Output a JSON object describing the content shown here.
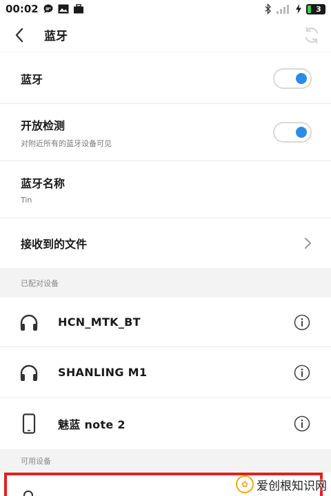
{
  "status_bar": {
    "time": "00:02",
    "battery_level": "3"
  },
  "header": {
    "title": "蓝牙"
  },
  "settings": {
    "bluetooth_label": "蓝牙",
    "bluetooth_enabled": true,
    "visibility_label": "开放检测",
    "visibility_sub": "对附近所有的蓝牙设备可见",
    "visibility_enabled": true,
    "name_label": "蓝牙名称",
    "name_value": "Tin",
    "received_files_label": "接收到的文件"
  },
  "paired": {
    "header": "已配对设备",
    "devices": [
      {
        "name": "HCN_MTK_BT",
        "icon": "headphones-icon"
      },
      {
        "name": "SHANLING M1",
        "icon": "headphones-icon"
      },
      {
        "name": "魅蓝 note 2",
        "icon": "phone-icon"
      }
    ]
  },
  "available": {
    "header": "可用设备"
  },
  "watermark": {
    "text": "爱创根知识网"
  },
  "colors": {
    "accent": "#2b8be8",
    "highlight": "#e21f1f",
    "section_bg": "#f3f3f3"
  }
}
